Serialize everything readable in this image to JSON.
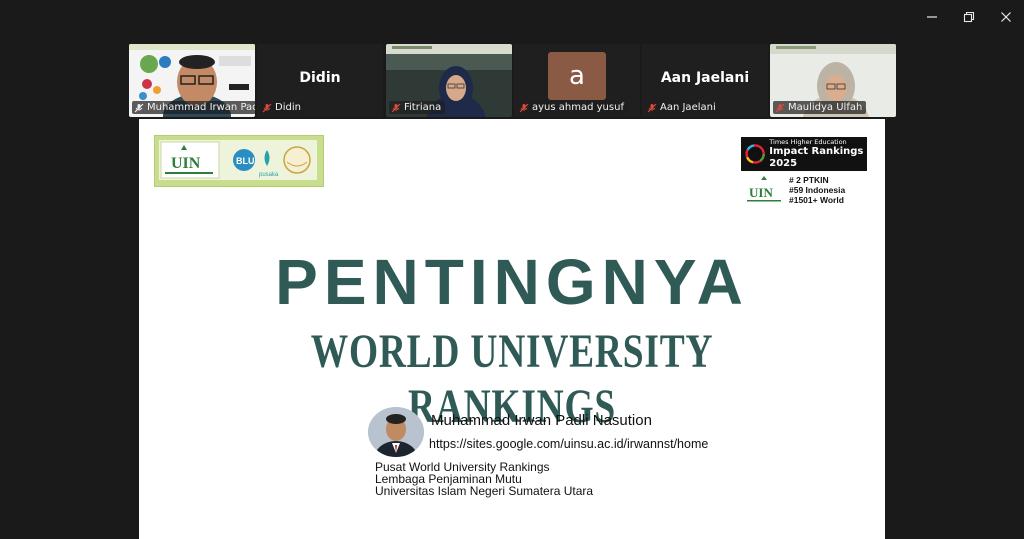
{
  "window": {
    "controls": [
      "minimize",
      "restore",
      "close"
    ]
  },
  "participants": [
    {
      "name": "Muhammad Irwan Pad...",
      "type": "video",
      "active": true
    },
    {
      "name": "Didin",
      "type": "name-only",
      "display_name": "Didin"
    },
    {
      "name": "Fitriana",
      "type": "video"
    },
    {
      "name": "ayus ahmad yusuf",
      "type": "avatar",
      "avatar_letter": "a"
    },
    {
      "name": "Aan Jaelani",
      "type": "name-only",
      "display_name": "Aan Jaelani"
    },
    {
      "name": "Maulidya Ulfah",
      "type": "video"
    }
  ],
  "slide": {
    "logos": {
      "uin": "UIN",
      "blu": "BLU",
      "pusaka": "pusaka"
    },
    "the_badge": {
      "line1": "Times Higher Education",
      "line2": "Impact Rankings 2025"
    },
    "ranks": [
      "# 2 PTKIN",
      "#59 Indonesia",
      "#1501+ World"
    ],
    "title_line1": "PENTINGNYA",
    "title_line2": "WORLD UNIVERSITY RANKINGS",
    "author_name": "Muhammad Irwan Padli Nasution",
    "author_url": "https://sites.google.com/uinsu.ac.id/irwannst/home",
    "affiliation": [
      "Pusat World University Rankings",
      "Lembaga Penjaminan Mutu",
      "Universitas Islam Negeri Sumatera Utara"
    ]
  },
  "colors": {
    "title": "#2f5a56",
    "active_speaker_border": "#3ddc84",
    "muted_mic": "#e0483e",
    "background": "#1a1a1a"
  }
}
